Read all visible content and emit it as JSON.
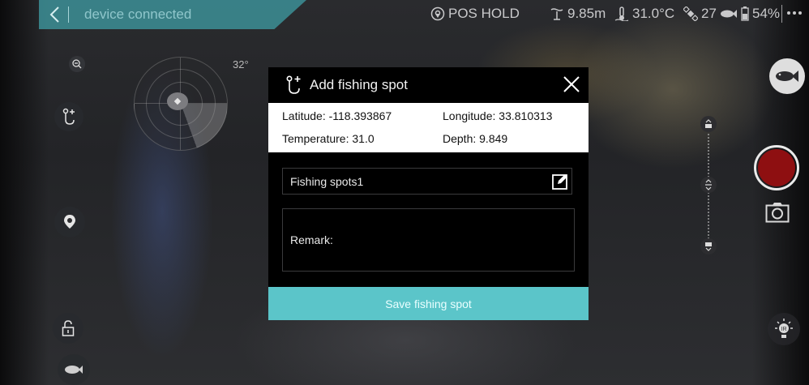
{
  "status_bar": {
    "device_status": "device connected",
    "mode": "POS HOLD",
    "depth": "9.85m",
    "temperature": "31.0°C",
    "satellites": "27",
    "battery": "54%"
  },
  "compass": {
    "heading": "32°"
  },
  "dialog": {
    "title": "Add fishing spot",
    "latitude": "Latitude: -118.393867",
    "longitude": "Longitude: 33.810313",
    "temperature": "Temperature: 31.0",
    "depth": "Depth: 9.849",
    "spot_name": "Fishing spots1",
    "remark_label": "Remark:",
    "save_label": "Save fishing spot"
  },
  "icons": {
    "back": "chevron-left-icon",
    "location": "location-pin-icon",
    "depth": "depth-waves-icon",
    "thermometer": "thermometer-icon",
    "satellite": "satellite-icon",
    "fish": "fish-icon",
    "battery": "battery-icon",
    "edit": "edit-icon",
    "close": "close-icon",
    "camera": "camera-icon",
    "lock": "lock-icon",
    "ir": "ir-light-icon"
  },
  "colors": {
    "accent": "#5bc5c9",
    "record": "#8e0f11"
  }
}
